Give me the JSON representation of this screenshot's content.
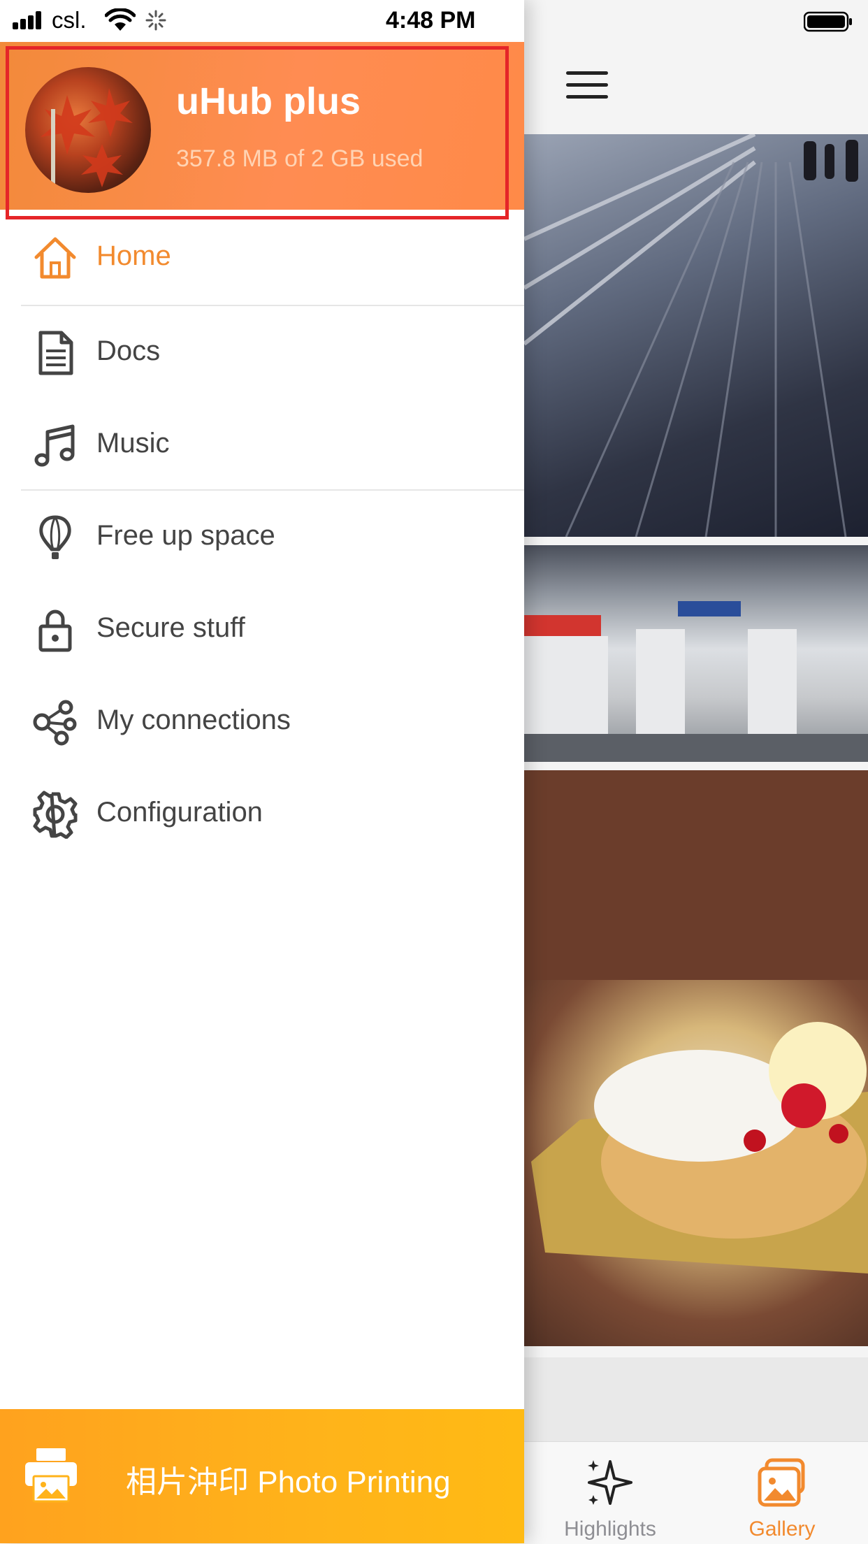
{
  "status_bar": {
    "carrier": "csl.",
    "time": "4:48 PM"
  },
  "drawer": {
    "header": {
      "title": "uHub plus",
      "storage_text": "357.8 MB of 2 GB used"
    },
    "menu": [
      {
        "label": "Home",
        "icon": "home-icon",
        "active": true
      },
      {
        "label": "Docs",
        "icon": "document-icon",
        "active": false
      },
      {
        "label": "Music",
        "icon": "music-note-icon",
        "active": false
      },
      {
        "label": "Free up space",
        "icon": "balloon-icon",
        "active": false
      },
      {
        "label": "Secure stuff",
        "icon": "lock-icon",
        "active": false
      },
      {
        "label": "My connections",
        "icon": "connections-icon",
        "active": false
      },
      {
        "label": "Configuration",
        "icon": "gear-icon",
        "active": false
      }
    ],
    "print_button": {
      "label": "相片沖印 Photo Printing",
      "icon": "printer-icon"
    }
  },
  "gallery": {
    "tabs": [
      {
        "label": "Highlights",
        "icon": "sparkle-icon",
        "active": false
      },
      {
        "label": "Gallery",
        "icon": "gallery-icon",
        "active": true
      }
    ]
  },
  "colors": {
    "accent": "#f28a2e",
    "header_orange": "#ff8c52",
    "print_bar": "#ffb31a",
    "highlight_border": "#e52528"
  }
}
